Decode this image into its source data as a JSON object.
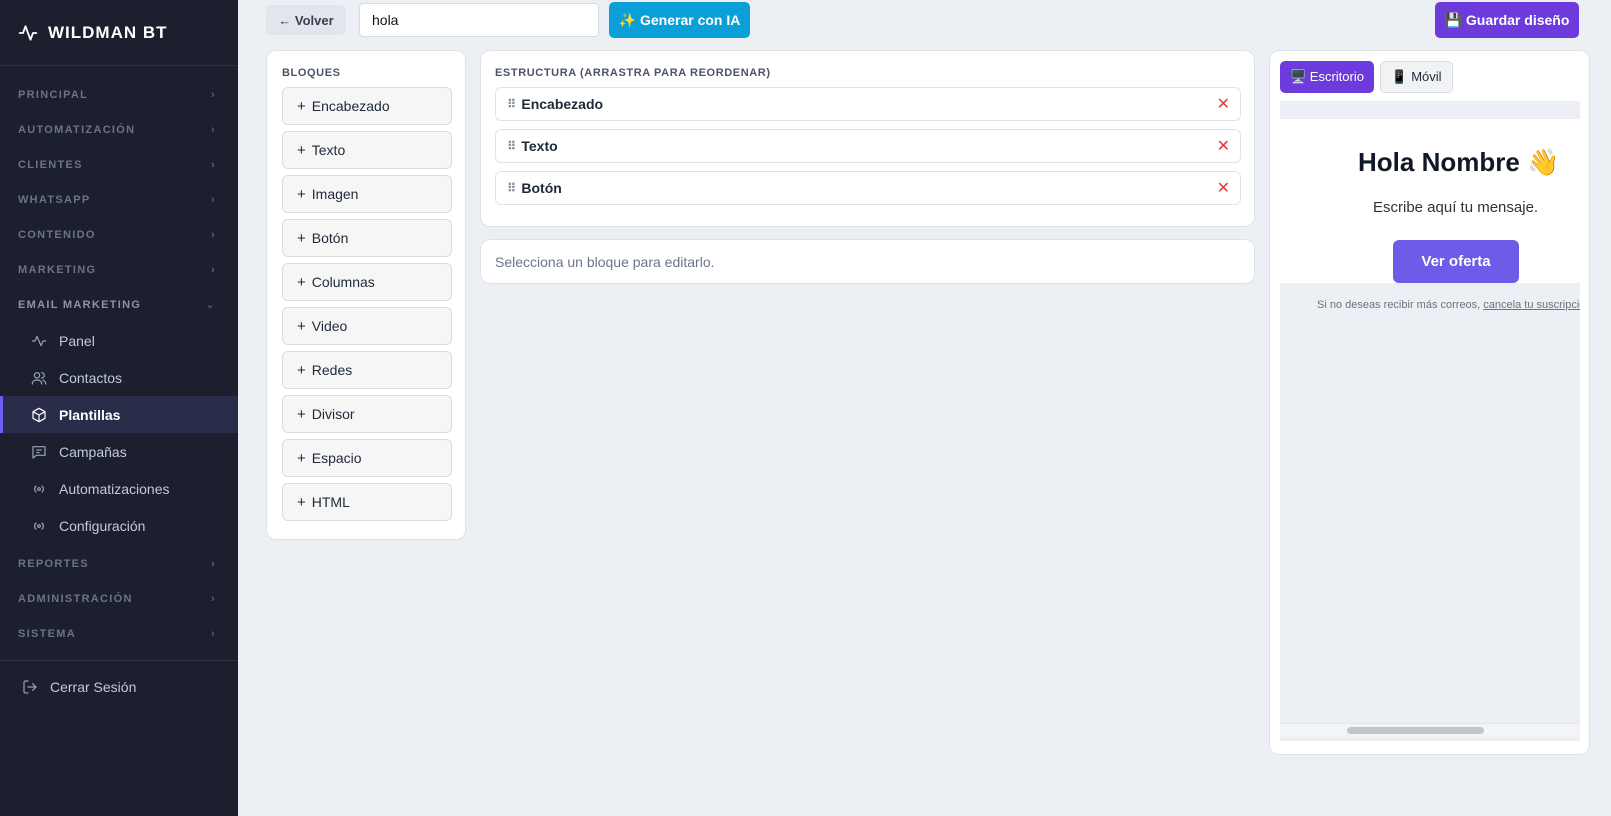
{
  "sidebar": {
    "brand": "WILDMAN BT",
    "sections_top": [
      {
        "label": "PRINCIPAL"
      },
      {
        "label": "AUTOMATIZACIÓN"
      },
      {
        "label": "CLIENTES"
      },
      {
        "label": "WHATSAPP"
      },
      {
        "label": "CONTENIDO"
      },
      {
        "label": "MARKETING"
      }
    ],
    "open_section": "EMAIL MARKETING",
    "items": [
      {
        "label": "Panel",
        "icon": "activity-icon"
      },
      {
        "label": "Contactos",
        "icon": "users-icon"
      },
      {
        "label": "Plantillas",
        "icon": "box-icon",
        "active": true
      },
      {
        "label": "Campañas",
        "icon": "message-icon"
      },
      {
        "label": "Automatizaciones",
        "icon": "radio-icon"
      },
      {
        "label": "Configuración",
        "icon": "radio-icon"
      }
    ],
    "sections_bottom": [
      {
        "label": "REPORTES"
      },
      {
        "label": "ADMINISTRACIÓN"
      },
      {
        "label": "SISTEMA"
      }
    ],
    "logout": "Cerrar Sesión"
  },
  "topbar": {
    "back_label": "← Volver",
    "template_name": "hola",
    "ai_label": "✨ Generar con IA",
    "save_label": "💾 Guardar diseño"
  },
  "blocks": {
    "title": "BLOQUES",
    "items": [
      "Encabezado",
      "Texto",
      "Imagen",
      "Botón",
      "Columnas",
      "Video",
      "Redes",
      "Divisor",
      "Espacio",
      "HTML"
    ]
  },
  "structure": {
    "title": "ESTRUCTURA (ARRASTRA PARA REORDENAR)",
    "rows": [
      "Encabezado",
      "Texto",
      "Botón"
    ],
    "remove_glyph": "✕",
    "grip_glyph": "⠿"
  },
  "editor": {
    "hint": "Selecciona un bloque para editarlo."
  },
  "preview": {
    "tab_desktop": "🖥️ Escritorio",
    "tab_mobile": "📱 Móvil",
    "heading": "Hola Nombre 👋",
    "text": "Escribe aquí tu mensaje.",
    "cta": "Ver oferta",
    "footer_text": "Si no deseas recibir más correos, ",
    "footer_link": "cancela tu suscripción"
  },
  "colors": {
    "sidebar_bg": "#1b1f2e",
    "accent_purple": "#6d3bdb",
    "ai_blue": "#0b9fd8",
    "cta_purple": "#6c5ce7",
    "remove_red": "#e23b3b"
  }
}
